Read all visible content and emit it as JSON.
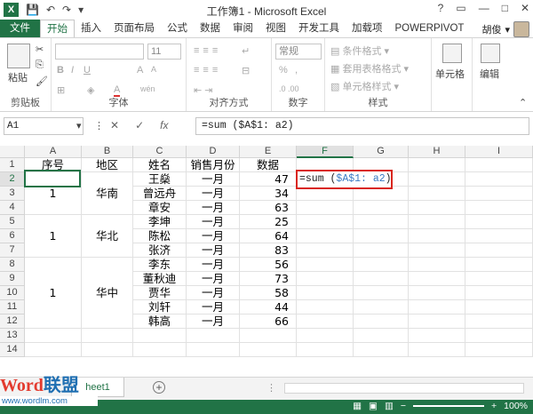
{
  "window": {
    "title": "工作簿1 - Microsoft Excel",
    "logo": "X"
  },
  "qat": {
    "save_icon": "save-icon",
    "undo_icon": "undo-icon",
    "redo_icon": "redo-icon"
  },
  "window_controls": [
    "?",
    "▭",
    "—",
    "□",
    "✕"
  ],
  "tabs": [
    "文件",
    "开始",
    "插入",
    "页面布局",
    "公式",
    "数据",
    "审阅",
    "视图",
    "开发工具",
    "加载项",
    "POWERPIVOT"
  ],
  "user": {
    "name": "胡俊"
  },
  "ribbon": {
    "clipboard": {
      "label": "剪贴板",
      "paste": "粘贴"
    },
    "font": {
      "label": "字体",
      "size": "11",
      "bold": "B",
      "italic": "I",
      "underline": "U",
      "grow": "A",
      "shrink": "A",
      "color": "A",
      "wen": "wén"
    },
    "alignment": {
      "label": "对齐方式"
    },
    "number": {
      "label": "数字",
      "format": "常规",
      "percent": "%"
    },
    "styles": {
      "label": "样式",
      "conditional": "条件格式",
      "table": "套用表格格式",
      "cell_style": "单元格样式"
    },
    "cells": {
      "label": "单元格"
    },
    "editing": {
      "label": "编辑"
    }
  },
  "formula_bar": {
    "namebox": "A1",
    "cancel": "✕",
    "enter": "✓",
    "fx": "fx",
    "formula": "=sum ($A$1: a2)"
  },
  "columns": [
    "A",
    "B",
    "C",
    "D",
    "E",
    "F",
    "G",
    "H",
    "I"
  ],
  "rows": [
    "1",
    "2",
    "3",
    "4",
    "5",
    "6",
    "7",
    "8",
    "9",
    "10",
    "11",
    "12",
    "13",
    "14"
  ],
  "headers": [
    "序号",
    "地区",
    "姓名",
    "销售月份",
    "数据"
  ],
  "merged": [
    {
      "id": "1",
      "region": "华南"
    },
    {
      "id": "1",
      "region": "华北"
    },
    {
      "id": "1",
      "region": "华中"
    }
  ],
  "names": [
    "王燊",
    "曾远舟",
    "章安",
    "李坤",
    "陈松",
    "张济",
    "李东",
    "董秋迪",
    "贾华",
    "刘轩",
    "韩高"
  ],
  "month": "一月",
  "values": [
    "47",
    "34",
    "63",
    "25",
    "64",
    "83",
    "56",
    "73",
    "58",
    "44",
    "66"
  ],
  "editing_cell": {
    "prefix": "=sum (",
    "ref": "$A$1: a2",
    "suffix": ")"
  },
  "sheet": {
    "tab": "heet1",
    "add": "+"
  },
  "status": {
    "zoom": "100%"
  },
  "watermark": {
    "word": "Word",
    "brand": "联盟",
    "url": "www.wordlm.com"
  }
}
